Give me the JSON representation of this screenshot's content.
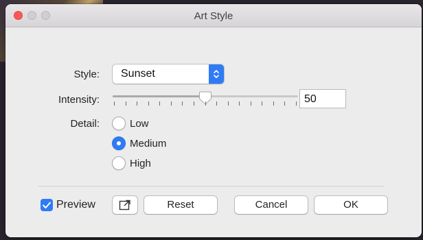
{
  "window": {
    "title": "Art Style"
  },
  "style": {
    "label": "Style:",
    "value": "Sunset"
  },
  "intensity": {
    "label": "Intensity:",
    "value": "50",
    "level_fraction": 0.5
  },
  "detail": {
    "label": "Detail:",
    "options": [
      {
        "label": "Low",
        "checked": false
      },
      {
        "label": "Medium",
        "checked": true
      },
      {
        "label": "High",
        "checked": false
      }
    ]
  },
  "footer": {
    "preview_label": "Preview",
    "preview_checked": true,
    "reset_label": "Reset",
    "cancel_label": "Cancel",
    "ok_label": "OK"
  },
  "colors": {
    "accent": "#2f7bf5",
    "close": "#fc5753"
  }
}
